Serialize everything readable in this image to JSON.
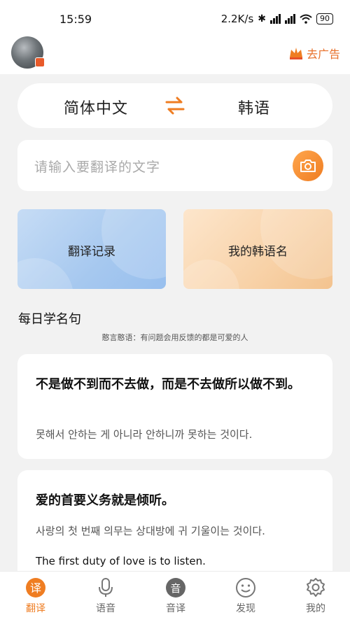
{
  "status_bar": {
    "time": "15:59",
    "net_speed": "2.2K/s",
    "battery": "90"
  },
  "header": {
    "ads_label": "去广告"
  },
  "lang": {
    "source": "简体中文",
    "target": "韩语"
  },
  "input": {
    "placeholder": "请输入要翻译的文字"
  },
  "cards": {
    "history": "翻译记录",
    "korean_name": "我的韩语名"
  },
  "daily": {
    "title": "每日学名句",
    "subtitle": "憨言憨语：有问题会用反馈的都是可爱的人"
  },
  "quotes": [
    {
      "cn": "不是做不到而不去做，而是不去做所以做不到。",
      "ko": "못해서 안하는 게 아니라 안하니까 못하는 것이다."
    },
    {
      "cn": "爱的首要义务就是倾听。",
      "ko": "사랑의 첫 번째 의무는 상대방에 귀 기울이는 것이다.",
      "en": "The first duty of love is to listen."
    }
  ],
  "tabs": [
    {
      "label": "翻译",
      "icon": "translate-icon",
      "active": true
    },
    {
      "label": "语音",
      "icon": "microphone-icon",
      "active": false
    },
    {
      "label": "音译",
      "icon": "phonetic-icon",
      "active": false
    },
    {
      "label": "发现",
      "icon": "discover-icon",
      "active": false
    },
    {
      "label": "我的",
      "icon": "settings-gear-icon",
      "active": false
    }
  ],
  "colors": {
    "accent": "#ef7d22",
    "background": "#f2f2f2"
  }
}
